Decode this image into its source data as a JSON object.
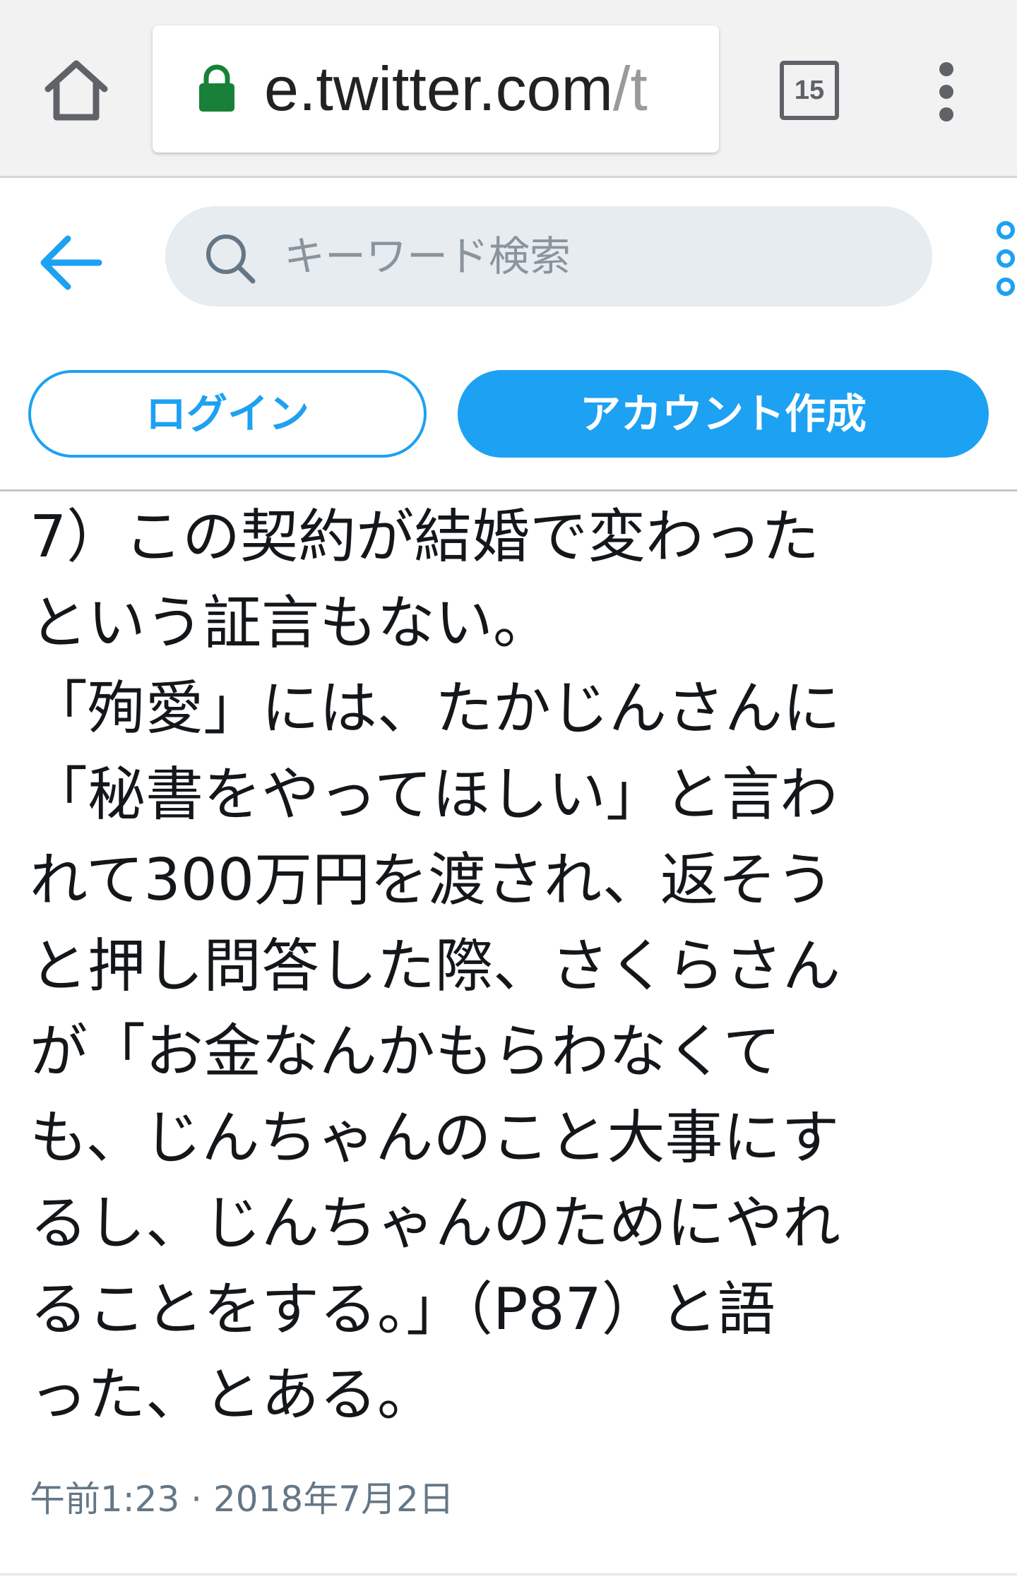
{
  "browser": {
    "url_host": "e.twitter.com",
    "url_rest": "/t",
    "tab_count": "15"
  },
  "header": {
    "search_placeholder": "キーワード検索",
    "login_label": "ログイン",
    "signup_label": "アカウント作成"
  },
  "tweet": {
    "text": "7）この契約が結婚で変わった\nという証言もない。\n「殉愛」には、たかじんさんに\n「秘書をやってほしい」と言わ\nれて300万円を渡され、返そう\nと押し問答した際、さくらさん\nが「お金なんかもらわなくて\nも、じんちゃんのこと大事にす\nるし、じんちゃんのためにやれ\nることをする。」（P87）と語\nった、とある。",
    "timestamp": "午前1:23 · 2018年7月2日"
  },
  "colors": {
    "accent": "#1da1f2",
    "lock": "#188038",
    "search_bg": "#e6ecf0",
    "meta_text": "#657786"
  }
}
